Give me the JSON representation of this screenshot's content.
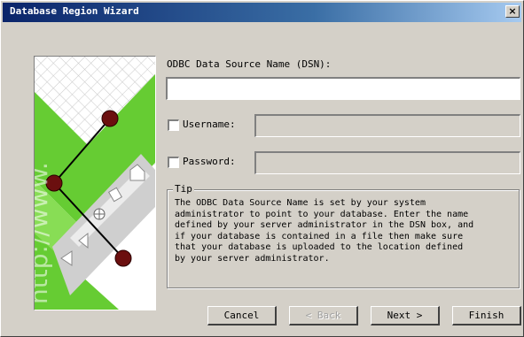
{
  "window": {
    "title": "Database Region Wizard",
    "close_glyph": "×"
  },
  "side_image": {
    "watermark": "http://www."
  },
  "dsn": {
    "label": "ODBC Data Source Name (DSN):",
    "value": ""
  },
  "username": {
    "label": "Username:",
    "checked": false,
    "value": ""
  },
  "password": {
    "label": "Password:",
    "checked": false,
    "value": ""
  },
  "tip": {
    "legend": "Tip",
    "text": "The ODBC Data Source Name is set by your system\nadministrator to point to your database.  Enter the name\ndefined by your server administrator in the DSN box, and\nif your database is contained in a file then make sure\nthat your database is uploaded to the location defined\nby your server administrator."
  },
  "buttons": {
    "cancel": "Cancel",
    "back": "< Back",
    "next": "Next >",
    "finish": "Finish"
  },
  "colors": {
    "dialog_bg": "#d4d0c8",
    "title_start": "#0a246a",
    "title_end": "#a6caf0",
    "image_green": "#66cc33",
    "node_red": "#6b0f0f"
  }
}
